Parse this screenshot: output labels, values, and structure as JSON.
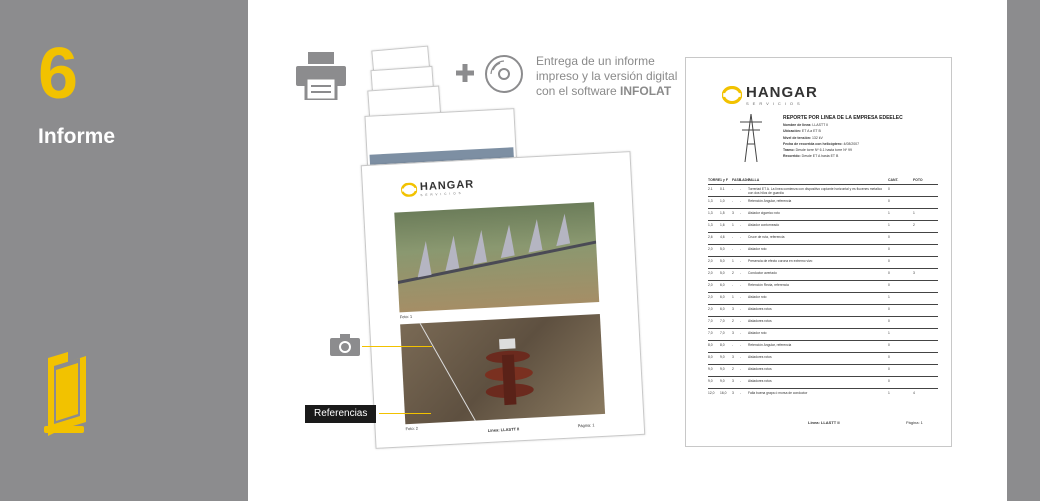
{
  "step": {
    "number": "6",
    "title": "Informe"
  },
  "caption": {
    "line1": "Entrega de un informe",
    "line2": "impreso y la versión digital",
    "line3_prefix": "con el software ",
    "line3_bold": "INFOLAT"
  },
  "logo": {
    "brand": "HANGAR",
    "sub": "SERVICIOS"
  },
  "front_page": {
    "photo1_label": "Foto:",
    "photo1_num": "1",
    "photo2_label": "Foto:",
    "photo2_num": "2",
    "footer_line": "Linea: LLASTT II",
    "footer_page": "Página: 1"
  },
  "report": {
    "title": "REPORTE POR LINEA DE LA EMPRESA EDEELEC",
    "meta": [
      {
        "k": "Nombre de linea:",
        "v": "LLASTT II"
      },
      {
        "k": "Ubicación:",
        "v": "ET A a ET B"
      },
      {
        "k": "Nivel de tensión:",
        "v": "132 kV"
      },
      {
        "k": "Fecha de recorrida con helicóptero:",
        "v": "4/08/2007"
      },
      {
        "k": "Tramo:",
        "v": "Desde torre Nº 6.1   hasta torre Nº 99"
      },
      {
        "k": "Recorrido:",
        "v": "Desde ET A hasta ET B"
      }
    ],
    "headers": [
      "TORRE",
      "1 y F",
      "FASE",
      "LADO",
      "FALLA",
      "CANT.",
      "FOTO"
    ],
    "rows": [
      [
        "2.1",
        "0.1",
        "-",
        "-",
        "Torreriad ET A. La línea comienza con dispositivo copiante horizontal y es fiucenes metalico con dos hilos de guardia",
        "0",
        ""
      ],
      [
        "1,3",
        "1,0",
        "-",
        "-",
        "Retención Angular, referencia",
        "0",
        ""
      ],
      [
        "1,3",
        "1,5",
        "3",
        "-",
        "Aislador cigarrico roto",
        "1",
        "1"
      ],
      [
        "1,3",
        "1,6",
        "1",
        "-",
        "Aislador contorneado",
        "1",
        "2"
      ],
      [
        "2,6",
        "4,6",
        "-",
        "-",
        "Cruce de ruta, referencia",
        "0",
        ""
      ],
      [
        "2,0",
        "5,0",
        "-",
        "-",
        "Aislador roto",
        "0",
        ""
      ],
      [
        "2,0",
        "5,0",
        "1",
        "-",
        "Presencia de efecto corona en extremo vivo",
        "0",
        ""
      ],
      [
        "2,0",
        "5,0",
        "2",
        "-",
        "Conductor averiado",
        "0",
        "3"
      ],
      [
        "2,0",
        "6,0",
        "-",
        "-",
        "Retención Recta, referencia",
        "0",
        ""
      ],
      [
        "2,0",
        "6,0",
        "1",
        "-",
        "Aislador roto",
        "1",
        ""
      ],
      [
        "2,0",
        "6,0",
        "3",
        "-",
        "Aisladores rotos",
        "0",
        ""
      ],
      [
        "7,0",
        "7,0",
        "2",
        "-",
        "Aisladores rotos",
        "0",
        ""
      ],
      [
        "7,0",
        "7,0",
        "3",
        "-",
        "Aislador roto",
        "1",
        ""
      ],
      [
        "8,0",
        "8,0",
        "-",
        "-",
        "Retención Angular, referencia",
        "0",
        ""
      ],
      [
        "8,0",
        "9,0",
        "3",
        "-",
        "Aisladores rotos",
        "0",
        ""
      ],
      [
        "9,0",
        "9,0",
        "2",
        "-",
        "Aisladores rotos",
        "0",
        ""
      ],
      [
        "9,0",
        "9,0",
        "3",
        "-",
        "Aisladores rotos",
        "0",
        ""
      ],
      [
        "12,0",
        "16,0",
        "3",
        "-",
        "Falla buena grapa ó morsa de conductor",
        "1",
        "4"
      ]
    ],
    "footer_line": "Linea: LLASTT II",
    "footer_page": "Página: 1"
  },
  "referencias_label": "Referencias",
  "colors": {
    "accent": "#f2c200",
    "side_panel": "#8c8c8e"
  }
}
